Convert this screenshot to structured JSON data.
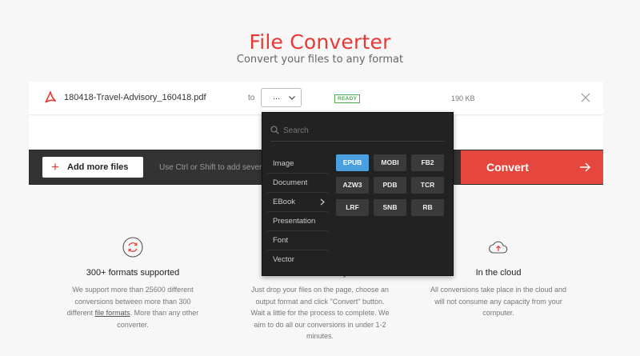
{
  "header": {
    "title": "File Converter",
    "subtitle": "Convert your files to any format"
  },
  "file": {
    "name": "180418-Travel-Advisory_160418.pdf",
    "to_label": "to",
    "format_value": "...",
    "status": "READY",
    "size": "190 KB"
  },
  "actions": {
    "add_files_label": "Add more files",
    "hint": "Use Ctrl or Shift to add several fil",
    "convert_label": "Convert"
  },
  "dropdown": {
    "search_placeholder": "Search",
    "categories": [
      "Image",
      "Document",
      "EBook",
      "Presentation",
      "Font",
      "Vector"
    ],
    "selected_category": "EBook",
    "formats": [
      "EPUB",
      "MOBI",
      "FB2",
      "AZW3",
      "PDB",
      "TCR",
      "LRF",
      "SNB",
      "RB"
    ],
    "selected_format": "EPUB"
  },
  "features": [
    {
      "icon": "refresh-icon",
      "title": "300+ formats supported",
      "text_before_link": "We support more than 25600 different conversions between more than 300 different ",
      "link": "file formats",
      "text_after_link": ". More than any other converter."
    },
    {
      "icon": "",
      "title": "Fast and easy",
      "text": "Just drop your files on the page, choose an output format and click \"Convert\" button. Wait a little for the process to complete. We aim to do all our conversions in under 1-2 minutes."
    },
    {
      "icon": "cloud-upload-icon",
      "title": "In the cloud",
      "text": "All conversions take place in the cloud and will not consume any capacity from your computer."
    }
  ],
  "colors": {
    "accent": "#e53935",
    "convert_bg": "#e5473e",
    "selected_format_bg": "#4a9fdf",
    "ready_green": "#4caf50"
  }
}
